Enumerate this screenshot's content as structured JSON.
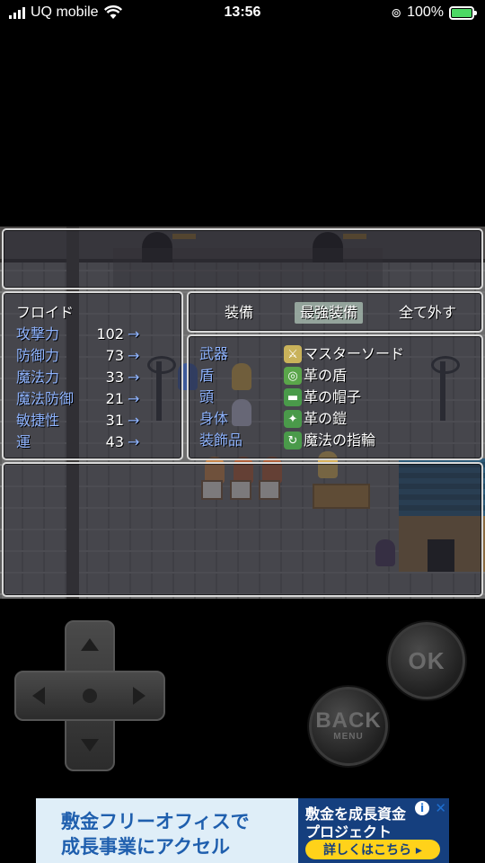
{
  "status_bar": {
    "carrier": "UQ mobile",
    "time": "13:56",
    "battery": "100%",
    "battery_level": 1.0
  },
  "character": {
    "name": "フロイド",
    "stats": [
      {
        "label": "攻撃力",
        "value": "102",
        "arrow": "→"
      },
      {
        "label": "防御力",
        "value": "73",
        "arrow": "→"
      },
      {
        "label": "魔法力",
        "value": "33",
        "arrow": "→"
      },
      {
        "label": "魔法防御",
        "value": "21",
        "arrow": "→"
      },
      {
        "label": "敏捷性",
        "value": "31",
        "arrow": "→"
      },
      {
        "label": "運",
        "value": "43",
        "arrow": "→"
      }
    ]
  },
  "commands": {
    "items": [
      "装備",
      "最強装備",
      "全て外す"
    ],
    "selected_index": 1
  },
  "equipment": {
    "slots": [
      {
        "slot": "武器",
        "item": "マスターソード",
        "icon": "sword-icon"
      },
      {
        "slot": "盾",
        "item": "革の盾",
        "icon": "shield-icon"
      },
      {
        "slot": "頭",
        "item": "革の帽子",
        "icon": "hat-icon"
      },
      {
        "slot": "身体",
        "item": "革の鎧",
        "icon": "armor-icon"
      },
      {
        "slot": "装飾品",
        "item": "魔法の指輪",
        "icon": "ring-icon"
      }
    ]
  },
  "controls": {
    "ok_label": "OK",
    "back_label": "BACK",
    "back_sub": "MENU"
  },
  "ad": {
    "line1": "敷金フリーオフィスで",
    "line2": "成長事業にアクセル",
    "right_line1": "敷金を成長資金",
    "right_line2": "プロジェクト",
    "cta": "詳しくはこちら ▸",
    "info": "i",
    "close": "✕"
  },
  "colors": {
    "label_blue": "#8fb4ff",
    "window_border": "#d9d9d9",
    "selected_highlight": "#bed7c8",
    "ad_blue": "#1f5fae",
    "ad_button": "#ffd21a"
  }
}
